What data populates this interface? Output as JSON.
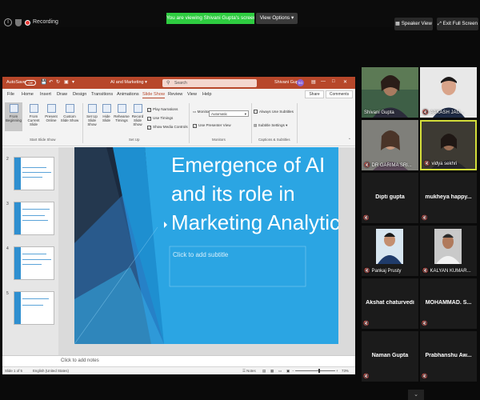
{
  "zoom": {
    "recording_label": "Recording",
    "viewing_banner": "You are viewing Shivani Gupta's screen",
    "view_options": "View Options",
    "speaker_view": "Speaker View",
    "exit_fullscreen": "Exit Full Screen"
  },
  "ppt": {
    "autosave": "AutoSave",
    "autosave_state": "Off",
    "filename": "AI and Marketing",
    "search_placeholder": "Search",
    "user": "Shivani Gupta",
    "avatar": "SG",
    "menu": [
      "File",
      "Home",
      "Insert",
      "Draw",
      "Design",
      "Transitions",
      "Animations",
      "Slide Show",
      "Review",
      "View",
      "Help"
    ],
    "active_menu": "Slide Show",
    "share": "Share",
    "comments": "Comments",
    "ribbon": {
      "from_beginning": "From Beginning",
      "from_current": "From Current Slide",
      "present_online": "Present Online",
      "custom_show": "Custom Slide Show",
      "setup_show": "Set Up Slide Show",
      "hide_slide": "Hide Slide",
      "rehearse": "Rehearse Timings",
      "record": "Record Slide Show",
      "play_narrations": "Play Narrations",
      "use_timings": "Use Timings",
      "show_media": "Show Media Controls",
      "monitor_label": "Monitor:",
      "monitor_value": "Automatic",
      "presenter_view": "Use Presenter View",
      "always_subtitles": "Always Use Subtitles",
      "subtitle_settings": "Subtitle Settings",
      "group_start": "Start Slide Show",
      "group_setup": "Set Up",
      "group_monitors": "Monitors",
      "group_captions": "Captions & Subtitles"
    },
    "thumbnails": [
      "2",
      "3",
      "4",
      "5"
    ],
    "slide": {
      "title_line1": "Emergence of AI",
      "title_line2": "and its role in",
      "title_line3": "Marketing Analytics",
      "subtitle_placeholder": "Click to add subtitle"
    },
    "notes_placeholder": "Click to add notes",
    "status_slide": "Slide 1 of 5",
    "status_lang": "English (United States)",
    "status_notes": "Notes",
    "zoom_percent": "73%"
  },
  "participants": [
    {
      "name": "Shivani Gupta",
      "video": true,
      "muted": false
    },
    {
      "name": "AAKASH JAU...",
      "video": true,
      "muted": true
    },
    {
      "name": "DR GARIMA SRI...",
      "video": true,
      "muted": true
    },
    {
      "name": "vidya sekhri",
      "video": true,
      "muted": true,
      "active": true
    },
    {
      "name": "Dipti gupta",
      "video": false,
      "muted": true
    },
    {
      "name": "mukheya happy...",
      "video": false,
      "muted": true
    },
    {
      "name": "Pankaj Prusty",
      "video": true,
      "muted": true
    },
    {
      "name": "KALYAN KUMAR...",
      "video": true,
      "muted": true
    },
    {
      "name": "Akshat chaturvedi",
      "video": false,
      "muted": true
    },
    {
      "name": "MOHAMMAD. S...",
      "video": false,
      "muted": true
    },
    {
      "name": "Naman Gupta",
      "video": false,
      "muted": true
    },
    {
      "name": "Prabhanshu Aw...",
      "video": false,
      "muted": true
    }
  ]
}
